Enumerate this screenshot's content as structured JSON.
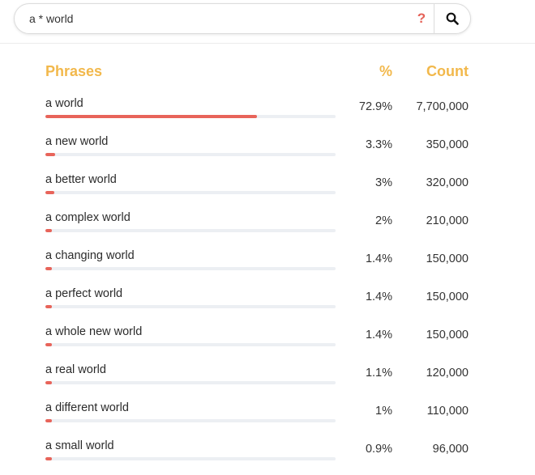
{
  "search": {
    "value": "a * world",
    "help_symbol": "?"
  },
  "table": {
    "headers": {
      "phrases": "Phrases",
      "percent": "%",
      "count": "Count"
    },
    "rows": [
      {
        "phrase": "a world",
        "percent": "72.9%",
        "count": "7,700,000",
        "share": 0.729
      },
      {
        "phrase": "a new world",
        "percent": "3.3%",
        "count": "350,000",
        "share": 0.033
      },
      {
        "phrase": "a better world",
        "percent": "3%",
        "count": "320,000",
        "share": 0.03
      },
      {
        "phrase": "a complex world",
        "percent": "2%",
        "count": "210,000",
        "share": 0.02
      },
      {
        "phrase": "a changing world",
        "percent": "1.4%",
        "count": "150,000",
        "share": 0.014
      },
      {
        "phrase": "a perfect world",
        "percent": "1.4%",
        "count": "150,000",
        "share": 0.014
      },
      {
        "phrase": "a whole new world",
        "percent": "1.4%",
        "count": "150,000",
        "share": 0.014
      },
      {
        "phrase": "a real world",
        "percent": "1.1%",
        "count": "120,000",
        "share": 0.011
      },
      {
        "phrase": "a different world",
        "percent": "1%",
        "count": "110,000",
        "share": 0.01
      },
      {
        "phrase": "a small world",
        "percent": "0.9%",
        "count": "96,000",
        "share": 0.009
      }
    ]
  },
  "colors": {
    "accent_header": "#f2b84b",
    "bar_fill": "#e8645a",
    "bar_track": "#eceff3",
    "help_icon": "#e56258"
  },
  "icons": {
    "help": "help-icon",
    "search": "search-icon"
  }
}
